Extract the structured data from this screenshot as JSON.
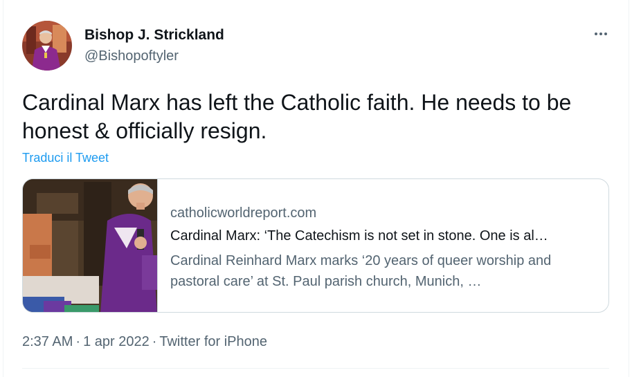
{
  "author": {
    "name": "Bishop J. Strickland",
    "handle": "@Bishopoftyler"
  },
  "tweet": {
    "text": "Cardinal Marx has left the Catholic faith. He needs to be honest & officially resign.",
    "translate_label": "Traduci il Tweet"
  },
  "card": {
    "domain": "catholicworldreport.com",
    "title": "Cardinal Marx: ‘The Catechism is not set in stone. One is al…",
    "description": "Cardinal Reinhard Marx marks ‘20 years of queer worship and pastoral care’ at St. Paul parish church, Munich, …"
  },
  "meta": {
    "time": "2:37 AM",
    "date": "1 apr 2022",
    "source": "Twitter for iPhone",
    "separator": "·"
  },
  "icons": {
    "more": "more-options-icon"
  },
  "colors": {
    "text_primary": "#0f1419",
    "text_secondary": "#536471",
    "link": "#1d9bf0",
    "border": "#cfd9de",
    "vestment_purple": "#6b2a8a"
  }
}
